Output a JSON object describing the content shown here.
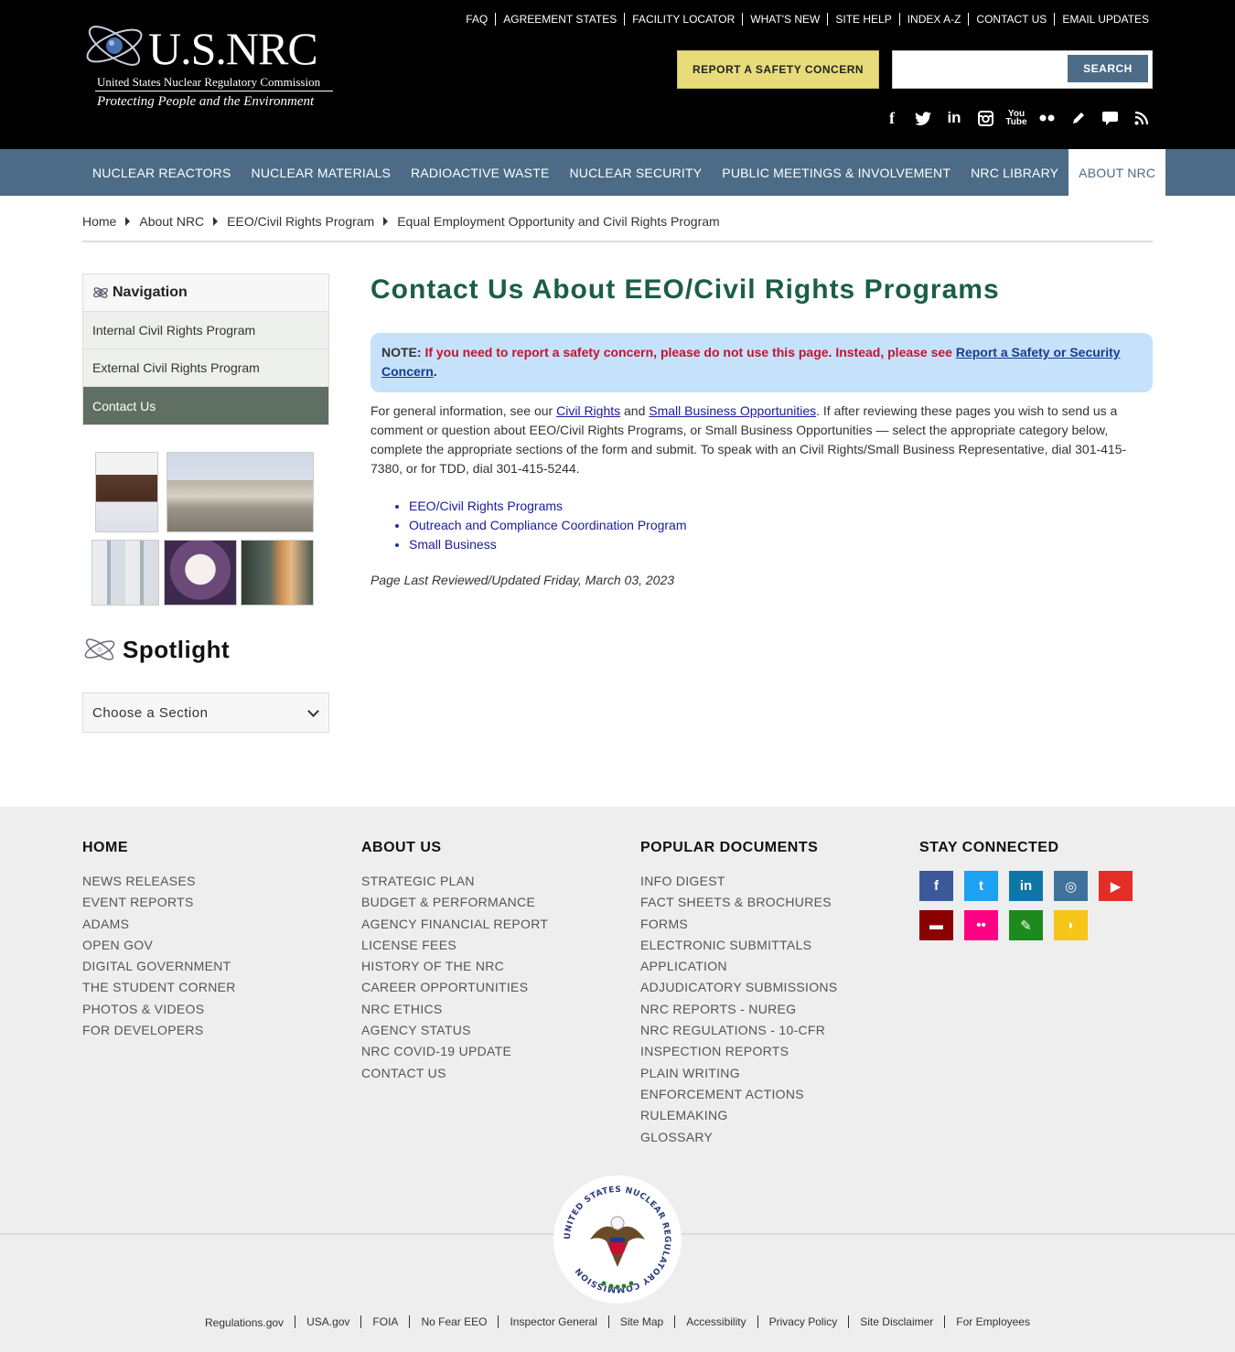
{
  "brand": {
    "title": "U.S.NRC",
    "subtitle": "United States Nuclear Regulatory Commission",
    "tagline": "Protecting People and the Environment"
  },
  "utility_links": [
    "FAQ",
    "AGREEMENT STATES",
    "FACILITY LOCATOR",
    "WHAT'S NEW",
    "SITE HELP",
    "INDEX A-Z",
    "CONTACT US",
    "EMAIL UPDATES"
  ],
  "header": {
    "report_button": "REPORT A SAFETY CONCERN",
    "search_placeholder": "",
    "search_button": "SEARCH",
    "social_icons": [
      "facebook-icon",
      "twitter-icon",
      "linkedin-icon",
      "instagram-icon",
      "youtube-icon",
      "flickr-icon",
      "blog-icon",
      "comment-icon",
      "rss-icon"
    ]
  },
  "main_nav": [
    "NUCLEAR REACTORS",
    "NUCLEAR MATERIALS",
    "RADIOACTIVE WASTE",
    "NUCLEAR SECURITY",
    "PUBLIC MEETINGS & INVOLVEMENT",
    "NRC LIBRARY",
    "ABOUT NRC"
  ],
  "main_nav_active": "ABOUT NRC",
  "breadcrumb": [
    "Home",
    "About NRC",
    "EEO/Civil Rights Program",
    "Equal Employment Opportunity and Civil Rights Program"
  ],
  "sidebar": {
    "heading": "Navigation",
    "items": [
      "Internal Civil Rights Program",
      "External Civil Rights Program",
      "Contact Us"
    ],
    "active": "Contact Us",
    "spotlight_title": "Spotlight",
    "spotlight_select": "Choose a Section"
  },
  "content": {
    "title": "Contact Us About EEO/Civil Rights Programs",
    "note_label": "NOTE:",
    "note_text": "If you need to report a safety concern, please do not use this page. Instead, please see",
    "note_link": "Report a Safety or Security Concern",
    "note_end": ".",
    "intro_1": "For general information, see our",
    "intro_link_1": "Civil Rights",
    "intro_and": "and",
    "intro_link_2": "Small Business Opportunities",
    "intro_2": ". If after reviewing these pages you wish to send us a comment or question about EEO/Civil Rights Programs, or Small Business Opportunities — select the appropriate category below, complete the appropriate sections of the form and submit. To speak with an Civil Rights/Small Business Representative, dial 301-415-7380, or for TDD, dial 301-415-5244.",
    "links": [
      "EEO/Civil Rights Programs",
      "Outreach and Compliance Coordination Program",
      "Small Business"
    ],
    "reviewed": "Page Last Reviewed/Updated Friday, March 03, 2023"
  },
  "footer": {
    "home": {
      "heading": "HOME",
      "items": [
        "NEWS RELEASES",
        "EVENT REPORTS",
        "ADAMS",
        "OPEN GOV",
        "DIGITAL GOVERNMENT",
        "THE STUDENT CORNER",
        "PHOTOS & VIDEOS",
        "FOR DEVELOPERS"
      ]
    },
    "about": {
      "heading": "ABOUT US",
      "items": [
        "STRATEGIC PLAN",
        "BUDGET & PERFORMANCE",
        "AGENCY FINANCIAL REPORT",
        "LICENSE FEES",
        "HISTORY OF THE NRC",
        "CAREER OPPORTUNITIES",
        "NRC ETHICS",
        "AGENCY STATUS",
        "NRC COVID-19 UPDATE",
        "CONTACT US"
      ]
    },
    "popular": {
      "heading": "POPULAR DOCUMENTS",
      "items": [
        "INFO DIGEST",
        "FACT SHEETS & BROCHURES",
        "FORMS",
        "ELECTRONIC SUBMITTALS",
        "APPLICATION",
        "ADJUDICATORY SUBMISSIONS",
        "NRC REPORTS - NUREG",
        "NRC REGULATIONS - 10-CFR",
        "INSPECTION REPORTS",
        "PLAIN WRITING",
        "ENFORCEMENT ACTIONS",
        "RULEMAKING",
        "GLOSSARY"
      ]
    },
    "connected": {
      "heading": "STAY CONNECTED",
      "icons": [
        {
          "name": "facebook-icon",
          "glyph": "f",
          "color": "#3b5998"
        },
        {
          "name": "twitter-icon",
          "glyph": "t",
          "color": "#1da1f2"
        },
        {
          "name": "linkedin-icon",
          "glyph": "in",
          "color": "#0e76a8"
        },
        {
          "name": "instagram-icon",
          "glyph": "◎",
          "color": "#3f729b"
        },
        {
          "name": "youtube-icon",
          "glyph": "▶",
          "color": "#e52d27"
        },
        {
          "name": "comment-icon",
          "glyph": "▬",
          "color": "#8b0000"
        },
        {
          "name": "flickr-icon",
          "glyph": "••",
          "color": "#ff0084"
        },
        {
          "name": "blog-icon",
          "glyph": "✎",
          "color": "#1d8a1d"
        },
        {
          "name": "rss-icon",
          "glyph": "◗",
          "color": "#f5c518"
        }
      ]
    },
    "seal_text": "UNITED STATES NUCLEAR REGULATORY COMMISSION",
    "bottom_links": [
      "Regulations.gov",
      "USA.gov",
      "FOIA",
      "No Fear EEO",
      "Inspector General",
      "Site Map",
      "Accessibility",
      "Privacy Policy",
      "Site Disclaimer",
      "For Employees"
    ]
  }
}
